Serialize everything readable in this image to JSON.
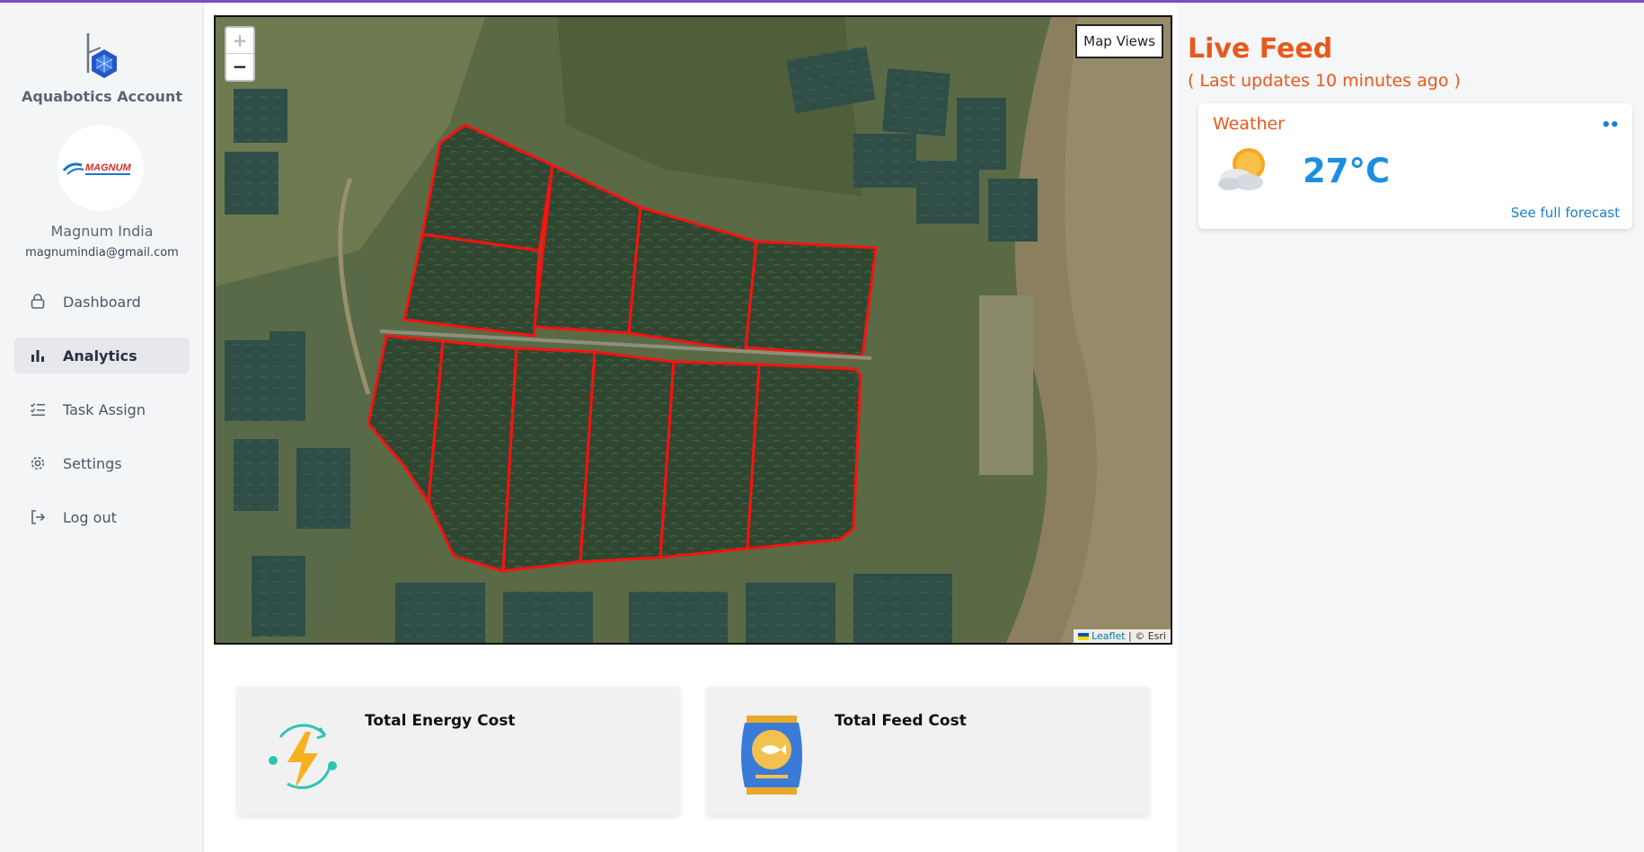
{
  "sidebar": {
    "account_name": "Aquabotics Account",
    "avatar_brand": "MAGNUM",
    "user_name": "Magnum India",
    "user_email": "magnumindia@gmail.com",
    "items": [
      {
        "label": "Dashboard",
        "icon": "lock-icon",
        "active": false
      },
      {
        "label": "Analytics",
        "icon": "bar-chart-icon",
        "active": true
      },
      {
        "label": "Task Assign",
        "icon": "checklist-icon",
        "active": false
      },
      {
        "label": "Settings",
        "icon": "gear-icon",
        "active": false
      },
      {
        "label": "Log out",
        "icon": "logout-icon",
        "active": false
      }
    ]
  },
  "map": {
    "zoom_in": "+",
    "zoom_out": "−",
    "views_button": "Map Views",
    "attribution_leaflet": "Leaflet",
    "attribution_rest": " | © Esri"
  },
  "cards": {
    "energy_title": "Total Energy Cost",
    "feed_title": "Total Feed Cost"
  },
  "live_feed": {
    "title": "Live Feed",
    "subtitle": "( Last updates 10 minutes ago )"
  },
  "weather": {
    "title": "Weather",
    "temperature": "27°C",
    "link": "See full forecast",
    "menu": "••"
  },
  "colors": {
    "accent_orange": "#e8581c",
    "link_blue": "#1a7fd0",
    "pond_outline": "#ff0000",
    "top_line": "#7a4fc0"
  }
}
